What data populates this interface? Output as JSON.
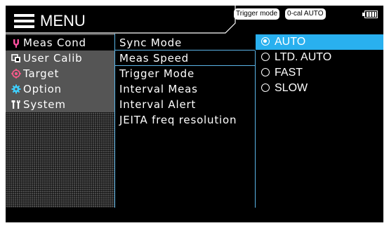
{
  "header": {
    "menu_label": "MENU",
    "trigger_badge": "Trigger mode",
    "cal_badge": "0-cal AUTO"
  },
  "sidebar": {
    "items": [
      {
        "label": "Meas Cond",
        "icon": "tuning-fork-icon",
        "color": "#ff4fa0",
        "active": true
      },
      {
        "label": "User Calib",
        "icon": "calibration-icon",
        "color": "#ffffff",
        "active": false
      },
      {
        "label": "Target",
        "icon": "target-icon",
        "color": "#ff5a8c",
        "active": false
      },
      {
        "label": "Option",
        "icon": "gear-icon",
        "color": "#3fd0ff",
        "active": false
      },
      {
        "label": "System",
        "icon": "tools-icon",
        "color": "#ffffff",
        "active": false
      }
    ]
  },
  "submenu": {
    "items": [
      {
        "label": "Sync Mode"
      },
      {
        "label": "Meas Speed"
      },
      {
        "label": "Trigger Mode"
      },
      {
        "label": "Interval Meas"
      },
      {
        "label": "Interval Alert"
      },
      {
        "label": "JEITA freq resolution"
      }
    ]
  },
  "options": {
    "items": [
      {
        "label": "AUTO",
        "selected": true
      },
      {
        "label": "LTD. AUTO",
        "selected": false
      },
      {
        "label": "FAST",
        "selected": false
      },
      {
        "label": "SLOW",
        "selected": false
      }
    ]
  },
  "colors": {
    "accent": "#29b0ef",
    "divider": "#5ab4e6",
    "background": "#000000"
  }
}
